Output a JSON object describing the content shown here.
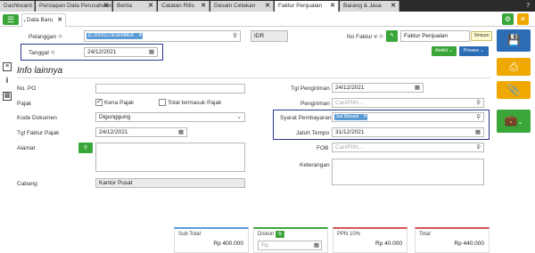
{
  "tabs": [
    {
      "label": "Dashboard"
    },
    {
      "label": "Persiapan Data Perusahaan"
    },
    {
      "label": "Berita"
    },
    {
      "label": "Catatan Rilis"
    },
    {
      "label": "Desain Cetakan"
    },
    {
      "label": "Faktur Penjualan"
    },
    {
      "label": "Barang & Jasa"
    }
  ],
  "tab_close": "✕",
  "top_counter": "7",
  "subtab": {
    "label": "Data Baru"
  },
  "form": {
    "pelanggan_label": "Pelanggan",
    "pelanggan_chip": "[C.00001] DESEMBER",
    "currency": "IDR",
    "nofaktur_label": "No Faktur #",
    "nofaktur_value": "Faktur Penjualan",
    "tooltip": "Simpan",
    "tanggal_label": "Tanggal",
    "tanggal_value": "24/12/2021",
    "ambil_label": "Ambil",
    "proses_label": "Proses",
    "section_title": "Info lainnya",
    "nopo_label": "No. PO",
    "pajak_label": "Pajak",
    "kena_pajak_label": "Kena Pajak",
    "total_pajak_label": "Total termasuk Pajak",
    "kode_dok_label": "Kode Dokumen",
    "kode_dok_value": "Digunggung",
    "tgl_pajak_label": "Tgl Faktur Pajak",
    "tgl_pajak_value": "24/12/2021",
    "alamat_label": "Alamat",
    "cabang_label": "Cabang",
    "cabang_value": "Kantor Pusat",
    "tgl_kirim_label": "Tgl Pengiriman",
    "tgl_kirim_value": "24/12/2021",
    "pengiriman_label": "Pengiriman",
    "pengiriman_placeholder": "Cari/Pilih...",
    "syarat_label": "Syarat Pembayaran",
    "syarat_chip": "Set Manual",
    "jatuh_tempo_label": "Jatuh Tempo",
    "jatuh_tempo_value": "31/12/2021",
    "fob_label": "FOB",
    "fob_placeholder": "Cari/Pilih...",
    "keterangan_label": "Keterangan",
    "diskon_placeholder": "Rp"
  },
  "totals": {
    "subtotal_label": "Sub Total",
    "subtotal_value": "Rp 400.000",
    "diskon_label": "Diskon",
    "diskon_badge": "%",
    "ppn_label": "PPN 10%",
    "ppn_value": "Rp 40.000",
    "total_label": "Total",
    "total_value": "Rp 440.000"
  },
  "colors": {
    "green": "#3aa63a",
    "blue": "#2d6db5",
    "orange": "#f0a800",
    "highlight_box": "#2c3590"
  },
  "icons": [
    "menu-icon",
    "search-icon",
    "calendar-icon",
    "pencil-icon",
    "gear-icon",
    "bulb-icon",
    "save-icon",
    "print-icon",
    "attach-icon",
    "briefcase-icon",
    "info-icon",
    "map-pin-icon",
    "chevron-down-icon"
  ]
}
